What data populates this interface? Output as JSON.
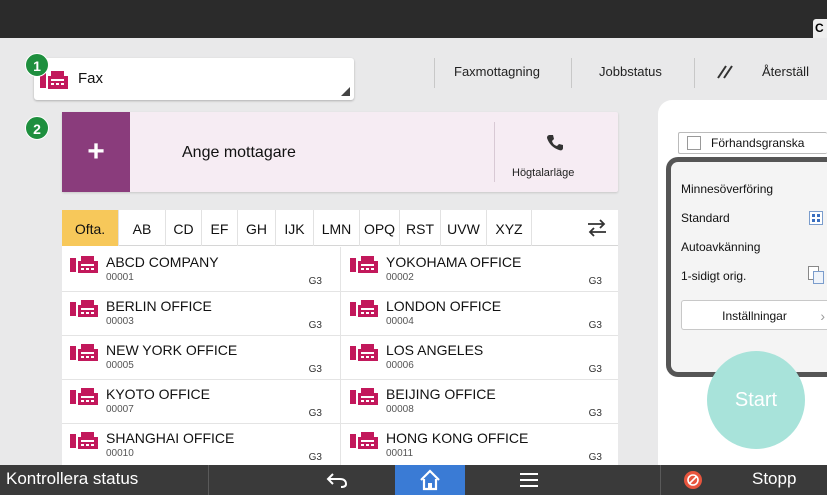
{
  "header": {
    "corner_text": "C"
  },
  "app": {
    "selected": "Fax"
  },
  "badges": {
    "one": "1",
    "two": "2"
  },
  "toplinks": {
    "fax_receive": "Faxmottagning",
    "job_status": "Jobbstatus",
    "reset": "Återställ"
  },
  "recipient": {
    "plus": "+",
    "label": "Ange mottagare",
    "speaker_label": "Högtalarläge"
  },
  "tabs": [
    "Ofta.",
    "AB",
    "CD",
    "EF",
    "GH",
    "IJK",
    "LMN",
    "OPQ",
    "RST",
    "UVW",
    "XYZ"
  ],
  "entries": [
    {
      "name": "ABCD COMPANY",
      "code": "00001",
      "type": "G3"
    },
    {
      "name": "YOKOHAMA OFFICE",
      "code": "00002",
      "type": "G3"
    },
    {
      "name": "BERLIN OFFICE",
      "code": "00003",
      "type": "G3"
    },
    {
      "name": "LONDON OFFICE",
      "code": "00004",
      "type": "G3"
    },
    {
      "name": "NEW YORK OFFICE",
      "code": "00005",
      "type": "G3"
    },
    {
      "name": "LOS ANGELES",
      "code": "00006",
      "type": "G3"
    },
    {
      "name": "KYOTO OFFICE",
      "code": "00007",
      "type": "G3"
    },
    {
      "name": "BEIJING OFFICE",
      "code": "00008",
      "type": "G3"
    },
    {
      "name": "SHANGHAI  OFFICE",
      "code": "00010",
      "type": "G3"
    },
    {
      "name": "HONG KONG OFFICE",
      "code": "00011",
      "type": "G3"
    }
  ],
  "right": {
    "preview": "Förhandsgranska",
    "memory_transfer": "Minnesöverföring",
    "standard": "Standard",
    "auto_detect": "Autoavkänning",
    "one_sided": "1-sidigt orig.",
    "settings": "Inställningar",
    "start": "Start"
  },
  "bottom": {
    "check_status": "Kontrollera status",
    "stop": "Stopp"
  },
  "colors": {
    "accent_purple": "#8a3c7c",
    "tab_active": "#f7c85a",
    "fax_icon": "#c2185b",
    "start": "#a8e3da",
    "badge": "#1e8f3e",
    "home": "#3a7bd5"
  }
}
